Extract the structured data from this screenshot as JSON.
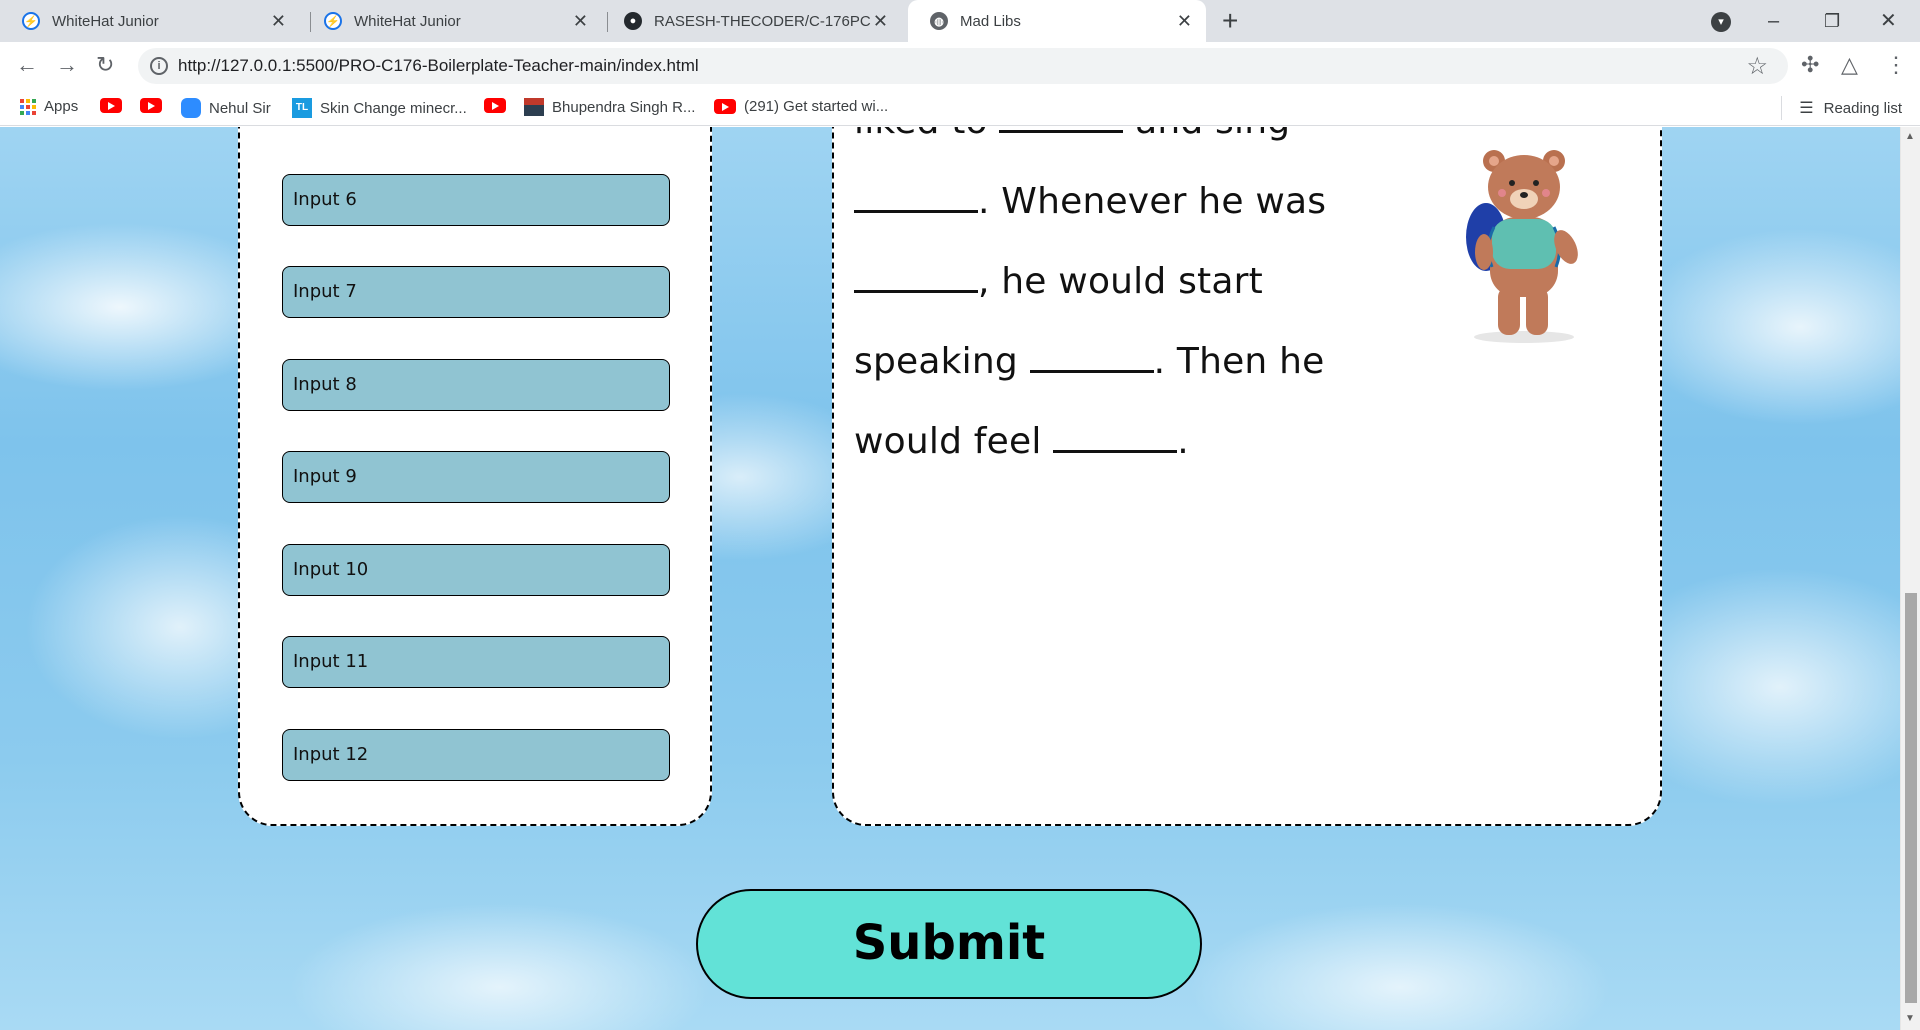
{
  "browser": {
    "tabs": [
      {
        "title": "WhiteHat Junior",
        "favicon": "whitehat-icon",
        "active": false
      },
      {
        "title": "WhiteHat Junior",
        "favicon": "whitehat-icon",
        "active": false
      },
      {
        "title": "RASESH-THECODER/C-176PC",
        "favicon": "github-icon",
        "active": false
      },
      {
        "title": "Mad Libs",
        "favicon": "globe-icon",
        "active": true
      }
    ],
    "close_glyph": "✕",
    "new_tab_glyph": "+",
    "url": "http://127.0.0.1:5500/PRO-C176-Boilerplate-Teacher-main/index.html",
    "bookmarks": [
      {
        "label": "Apps",
        "icon": "apps-grid-icon"
      },
      {
        "label": "",
        "icon": "youtube-icon"
      },
      {
        "label": "",
        "icon": "youtube-icon"
      },
      {
        "label": "Nehul Sir",
        "icon": "zoom-icon"
      },
      {
        "label": "Skin Change minecr...",
        "icon": "tl-icon"
      },
      {
        "label": "",
        "icon": "youtube-icon"
      },
      {
        "label": "Bhupendra Singh R...",
        "icon": "thumbnail-icon"
      },
      {
        "label": "(291) Get started wi...",
        "icon": "youtube-icon"
      }
    ],
    "reading_list": "Reading list"
  },
  "form": {
    "inputs": [
      {
        "placeholder": "Input 6"
      },
      {
        "placeholder": "Input 7"
      },
      {
        "placeholder": "Input 8"
      },
      {
        "placeholder": "Input 9"
      },
      {
        "placeholder": "Input 10"
      },
      {
        "placeholder": "Input 11"
      },
      {
        "placeholder": "Input 12"
      }
    ]
  },
  "story": {
    "line1a": "liked to",
    "line1b": "and sing",
    "line2b": ". Whenever he was",
    "line3b": ", he would start",
    "line4a": "speaking",
    "line4b": ". Then he",
    "line5a": "would feel",
    "line5b": "."
  },
  "submit_label": "Submit",
  "colors": {
    "input_fill": "#90c4d2",
    "submit_fill": "#62e2d7",
    "page_background": "#8ccbee"
  }
}
